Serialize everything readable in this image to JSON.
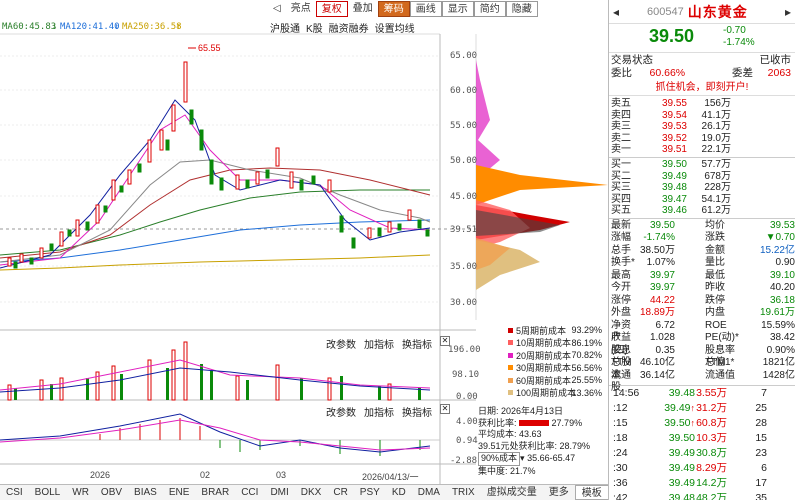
{
  "ma_legend": [
    {
      "label": "MA60:45.83",
      "color": "#2a7f2a"
    },
    {
      "label": "MA120:41.40",
      "color": "#1e6fd9"
    },
    {
      "label": "MA250:36.58",
      "color": "#c8a000"
    }
  ],
  "toolbar": [
    "亮点",
    "复权",
    "叠加",
    "筹码",
    "画线",
    "显示",
    "简约",
    "隐藏"
  ],
  "submenu": [
    "沪股通",
    "K股",
    "融资融券",
    "设置均线"
  ],
  "price_axis": [
    "65.00",
    "60.00",
    "55.00",
    "50.00",
    "45.00",
    "39.51",
    "35.00",
    "30.00"
  ],
  "peak_label": "65.55",
  "vol_header": [
    "改参数",
    "加指标",
    "换指标"
  ],
  "vol_axis": [
    "196.00",
    "98.10",
    "0.00"
  ],
  "macd_header": [
    "改参数",
    "加指标",
    "换指标"
  ],
  "macd_axis": [
    "4.00",
    "0.94",
    "-2.88"
  ],
  "date_labels": [
    "2026",
    "02",
    "03",
    "2026/04/13/一"
  ],
  "cost_legend": [
    {
      "label": "5周期前成本",
      "value": "93.29%",
      "color": "#d00000"
    },
    {
      "label": "10周期前成本",
      "value": "86.19%",
      "color": "#ff6060"
    },
    {
      "label": "20周期前成本",
      "value": "70.82%",
      "color": "#e0208a"
    },
    {
      "label": "30周期前成本",
      "value": "56.56%",
      "color": "#ff8c00"
    },
    {
      "label": "60周期前成本",
      "value": "25.55%",
      "color": "#f0a050"
    },
    {
      "label": "100周期前成本",
      "value": "13.36%",
      "color": "#e0c080"
    }
  ],
  "cost_info": {
    "date": "日期: 2026年4月13日",
    "profit_label": "获利比率:",
    "profit_value": "27.79%",
    "avg_cost": "平均成本: 43.63",
    "profit_at": "39.51元处获利比率: 28.79%",
    "range_select": "90%成本",
    "range_value": "35.66-65.47",
    "concentration": "集中度: 21.7%"
  },
  "tabs": [
    "CSI",
    "BOLL",
    "WR",
    "OBV",
    "BIAS",
    "ENE",
    "BRAR",
    "CCI",
    "DMI",
    "DKX",
    "CR",
    "PSY",
    "KD",
    "DMA",
    "TRIX",
    "虚拟成交量",
    "更多",
    "模板"
  ],
  "stock": {
    "code": "600547",
    "name": "山东黄金",
    "price": "39.50",
    "change": "-0.70",
    "change_pct": "-1.74%"
  },
  "status": {
    "label": "交易状态",
    "value": "已收市"
  },
  "ratio": {
    "wb_label": "委比",
    "wb_value": "60.66%",
    "wc_label": "委差",
    "wc_value": "2063"
  },
  "promo": "抓住机会，即刻开户!",
  "sell_orders": [
    {
      "label": "卖五",
      "price": "39.55",
      "vol": "156万"
    },
    {
      "label": "卖四",
      "price": "39.54",
      "vol": "41.1万"
    },
    {
      "label": "卖三",
      "price": "39.53",
      "vol": "26.1万"
    },
    {
      "label": "卖二",
      "price": "39.52",
      "vol": "19.0万"
    },
    {
      "label": "卖一",
      "price": "39.51",
      "vol": "22.1万"
    }
  ],
  "buy_orders": [
    {
      "label": "买一",
      "price": "39.50",
      "vol": "57.7万"
    },
    {
      "label": "买二",
      "price": "39.49",
      "vol": "678万"
    },
    {
      "label": "买三",
      "price": "39.48",
      "vol": "228万"
    },
    {
      "label": "买四",
      "price": "39.47",
      "vol": "54.1万"
    },
    {
      "label": "买五",
      "price": "39.46",
      "vol": "61.2万"
    }
  ],
  "quote": [
    [
      "最新",
      "39.50",
      "均价",
      "39.53"
    ],
    [
      "涨幅",
      "-1.74%",
      "涨跌",
      "▼0.70"
    ],
    [
      "总手",
      "38.50万",
      "金额",
      "15.22亿"
    ],
    [
      "换手*",
      "1.07%",
      "量比",
      "0.90"
    ],
    [
      "最高",
      "39.97",
      "最低",
      "39.10"
    ],
    [
      "今开",
      "39.97",
      "昨收",
      "40.20"
    ],
    [
      "涨停",
      "44.22",
      "跌停",
      "36.18"
    ],
    [
      "外盘",
      "18.89万",
      "内盘",
      "19.61万"
    ],
    [
      "净资产",
      "6.72",
      "ROE",
      "15.59%"
    ],
    [
      "收益(四)",
      "1.028",
      "PE(动)*",
      "38.42"
    ],
    [
      "股息TTM",
      "0.35",
      "股息率TTM",
      "0.90%"
    ],
    [
      "总股本",
      "46.10亿",
      "总值1*",
      "1821亿"
    ],
    [
      "流通股",
      "36.14亿",
      "流通值",
      "1428亿"
    ]
  ],
  "ticks": [
    {
      "time": "14:56",
      "price": "39.48",
      "vol": "3.55万",
      "n": "7",
      "dir": ""
    },
    {
      "time": ":12",
      "price": "39.49",
      "vol": "31.2万",
      "n": "25",
      "dir": "↑"
    },
    {
      "time": ":15",
      "price": "39.50",
      "vol": "60.8万",
      "n": "28",
      "dir": "↑"
    },
    {
      "time": ":18",
      "price": "39.50",
      "vol": "10.3万",
      "n": "15",
      "dir": ""
    },
    {
      "time": ":24",
      "price": "39.49",
      "vol": "30.8万",
      "n": "23",
      "dir": ""
    },
    {
      "time": ":30",
      "price": "39.49",
      "vol": "8.29万",
      "n": "6",
      "dir": ""
    },
    {
      "time": ":36",
      "price": "39.49",
      "vol": "14.2万",
      "n": "17",
      "dir": ""
    },
    {
      "time": ":42",
      "price": "39.48",
      "vol": "48.2万",
      "n": "35",
      "dir": ""
    }
  ]
}
